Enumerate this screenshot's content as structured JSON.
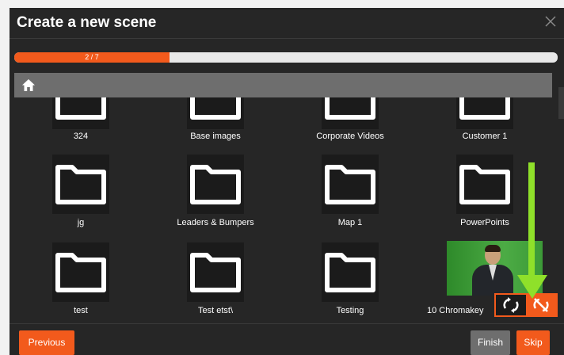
{
  "dialog": {
    "title": "Create a new scene",
    "close_icon": "close-icon"
  },
  "progress": {
    "text": "2 / 7",
    "fraction": 0.2857,
    "color": "#f25a1c"
  },
  "breadcrumb": {
    "home_icon": "home-icon"
  },
  "folders": [
    {
      "label": "324",
      "kind": "folder"
    },
    {
      "label": "Base images",
      "kind": "folder"
    },
    {
      "label": "Corporate Videos",
      "kind": "folder"
    },
    {
      "label": "Customer 1",
      "kind": "folder"
    },
    {
      "label": "jg",
      "kind": "folder"
    },
    {
      "label": "Leaders & Bumpers",
      "kind": "folder"
    },
    {
      "label": "Map 1",
      "kind": "folder"
    },
    {
      "label": "PowerPoints",
      "kind": "folder"
    },
    {
      "label": "test",
      "kind": "folder"
    },
    {
      "label": "Test etst\\",
      "kind": "folder"
    },
    {
      "label": "Testing",
      "kind": "folder"
    },
    {
      "label": "10 Chromakey",
      "kind": "video"
    }
  ],
  "swap_control": {
    "left_icon": "swap-icon",
    "right_icon": "swap-off-icon"
  },
  "annotation": {
    "arrow_color": "#8fe02a"
  },
  "footer": {
    "previous_label": "Previous",
    "finish_label": "Finish",
    "skip_label": "Skip"
  }
}
